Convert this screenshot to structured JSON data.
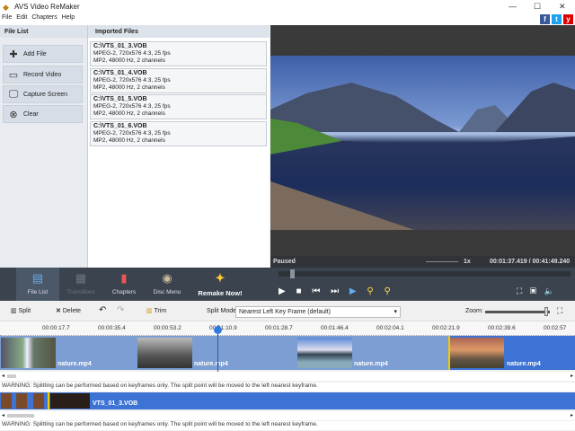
{
  "app": {
    "title": "AVS Video ReMaker"
  },
  "menu": [
    "File",
    "Edit",
    "Chapters",
    "Help"
  ],
  "social": [
    "f",
    "t",
    "y"
  ],
  "file_list": {
    "header": "File List",
    "buttons": [
      "Add File",
      "Record Video",
      "Capture Screen",
      "Clear"
    ]
  },
  "imported": {
    "header": "Imported Files",
    "files": [
      {
        "name": "C:\\VTS_01_3.VOB",
        "video": "MPEG-2, 720x576 4:3, 25 fps",
        "audio": "MP2, 48000 Hz, 2 channels"
      },
      {
        "name": "C:\\VTS_01_4.VOB",
        "video": "MPEG-2, 720x576 4:3, 25 fps",
        "audio": "MP2, 48000 Hz, 2 channels"
      },
      {
        "name": "C:\\VTS_01_5.VOB",
        "video": "MPEG-2, 720x576 4:3, 25 fps",
        "audio": "MP2, 48000 Hz, 2 channels"
      },
      {
        "name": "C:\\VTS_01_6.VOB",
        "video": "MPEG-2, 720x576 4:3, 25 fps",
        "audio": "MP2, 48000 Hz, 2 channels"
      }
    ]
  },
  "player": {
    "status": "Paused",
    "speed": "1x",
    "time": "00:01:37.419 / 00:41:49.240",
    "progress": 0.04
  },
  "main_toolbar": [
    "File List",
    "Transitions",
    "Chapters",
    "Disc Menu",
    "Remake Now!"
  ],
  "edit_toolbar": {
    "split": "Split",
    "delete": "Delete",
    "trim": "Trim",
    "split_mode_label": "Split Mode:",
    "split_mode_value": "Nearest Left Key Frame (default)",
    "zoom_label": "Zoom:"
  },
  "ruler": [
    "00:00:17.7",
    "00:00:35.4",
    "00:00:53.2",
    "00:01:10.9",
    "00:01:28.7",
    "00:01:46.4",
    "00:02:04.1",
    "00:02:21.9",
    "00:02:39.6",
    "00:02:57"
  ],
  "track1": {
    "clips": [
      "nature.mp4",
      "nature.mp4",
      "nature.mp4",
      "nature.mp4"
    ]
  },
  "track2": {
    "clip": "VTS_01_3.VOB"
  },
  "warning": "WARNING: Splitting can be performed based on keyframes only. The split point will be moved to the left nearest keyframe."
}
